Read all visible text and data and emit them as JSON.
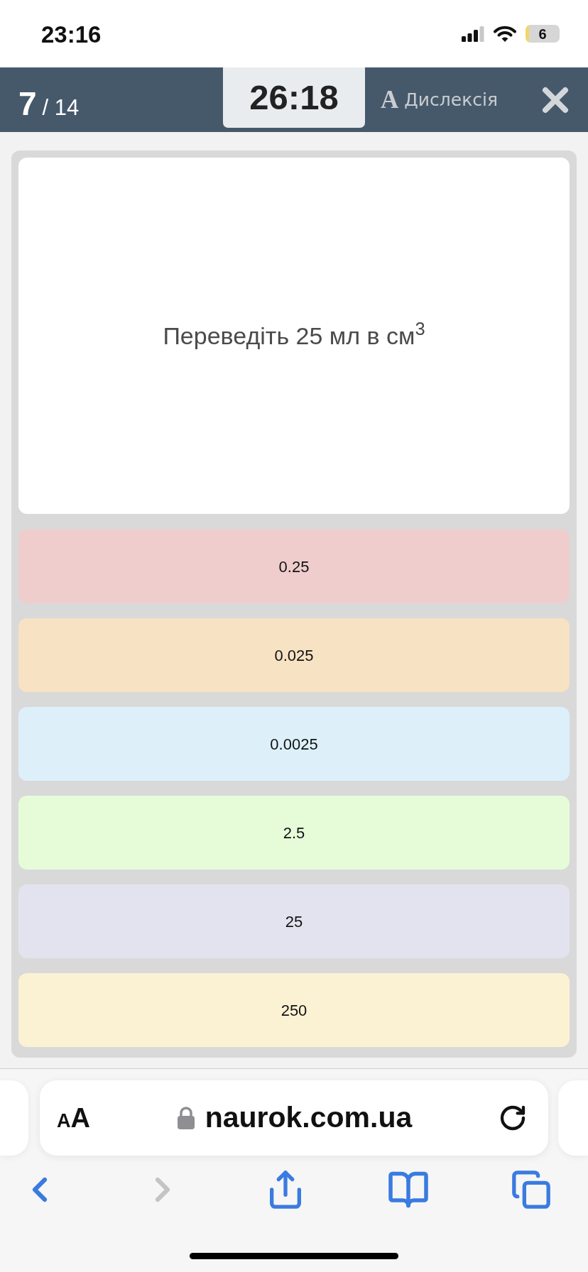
{
  "status_bar": {
    "time": "23:16",
    "battery": "6"
  },
  "quiz_header": {
    "counter": {
      "current": "7",
      "total": "/ 14"
    },
    "timer": "26:18",
    "dyslexia_button": {
      "letter": "A",
      "label": "Дислексія"
    }
  },
  "question": {
    "text": "Переведіть 25 мл в см$^{3}$"
  },
  "answers": [
    {
      "text": "0.25",
      "color": "#efcdcd"
    },
    {
      "text": "0.025",
      "color": "#f7e2c3"
    },
    {
      "text": "0.0025",
      "color": "#ddf0fa"
    },
    {
      "text": "2.5",
      "color": "#e6fcd9"
    },
    {
      "text": "25",
      "color": "#e3e3ef"
    },
    {
      "text": "250",
      "color": "#fbf2d3"
    }
  ],
  "browser": {
    "text_size_button": "AA",
    "url": "naurok.com.ua",
    "toolbar": [
      {
        "kind": "back",
        "disabled": false
      },
      {
        "kind": "forward",
        "disabled": true
      },
      {
        "kind": "share",
        "disabled": false
      },
      {
        "kind": "bookmarks",
        "disabled": false
      },
      {
        "kind": "tabs",
        "disabled": false
      }
    ]
  }
}
